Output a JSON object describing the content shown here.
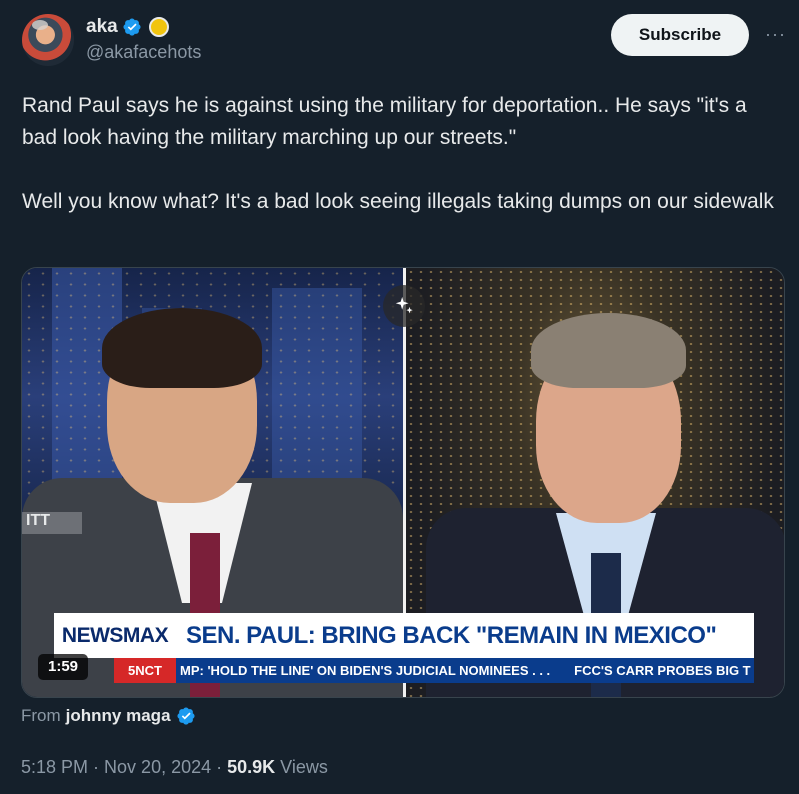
{
  "author": {
    "display_name": "aka",
    "handle": "@akafacehots"
  },
  "actions": {
    "subscribe_label": "Subscribe",
    "more_label": "···"
  },
  "tweet": {
    "paragraph_1": "Rand Paul says he is against using the military for deportation.. He says \"it's a bad look having the military marching up our streets.\"",
    "paragraph_2": "Well you know what? It's a bad look seeing illegals taking dumps on our sidewalk"
  },
  "video": {
    "duration": "1:59",
    "chyron_brand": "NEWSMAX",
    "chyron_headline": "SEN. PAUL: BRING BACK \"REMAIN IN MEXICO\"",
    "ticker_items": [
      "MP: 'HOLD THE LINE' ON BIDEN'S JUDICIAL NOMINEES . . .",
      "FCC'S CARR PROBES BIG T"
    ],
    "ticker_logo": "5NCT",
    "left_tag": "ITT"
  },
  "attribution": {
    "from_label": "From",
    "from_user": "johnny maga"
  },
  "meta": {
    "time": "5:18 PM",
    "separator_1": "·",
    "date": "Nov 20, 2024",
    "separator_2": "·",
    "views_count": "50.9K",
    "views_label": "Views"
  },
  "colors": {
    "background": "#15202b",
    "verified_blue": "#1d9bf0",
    "gold_badge": "#f1c40f",
    "newsmax_blue": "#0a3c8c"
  }
}
